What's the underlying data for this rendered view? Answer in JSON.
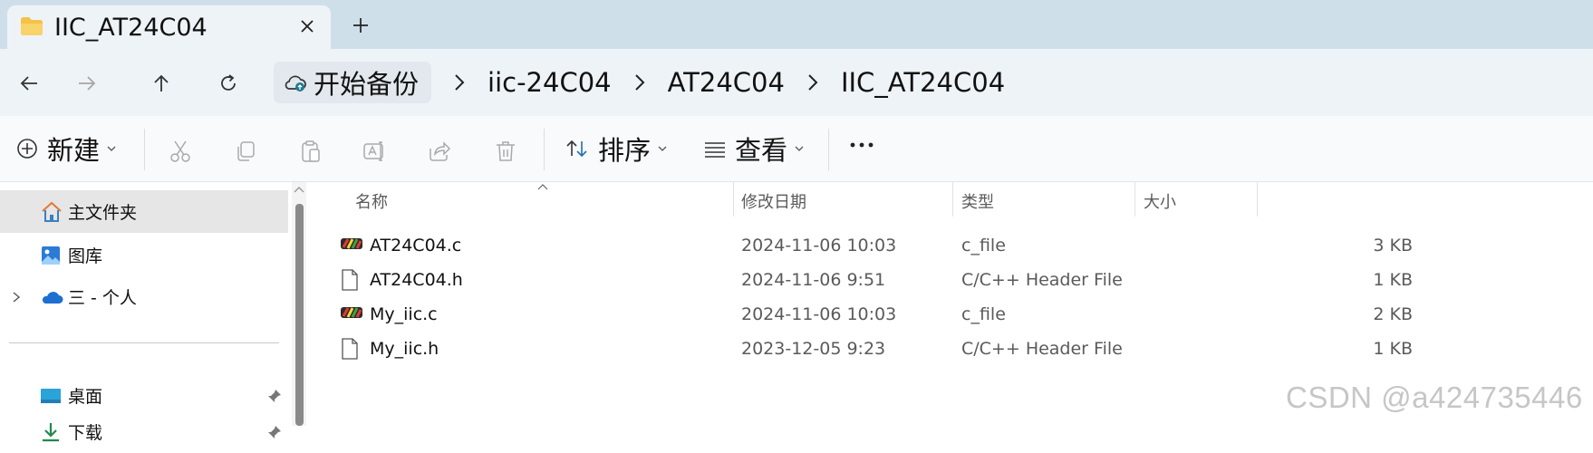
{
  "tab": {
    "title": "IIC_AT24C04",
    "icon": "folder-icon",
    "close_icon": "close-icon",
    "new_tab_icon": "plus-icon"
  },
  "nav": {
    "back_icon": "arrow-left-icon",
    "forward_icon": "arrow-right-icon",
    "up_icon": "arrow-up-icon",
    "refresh_icon": "refresh-icon"
  },
  "breadcrumbs": {
    "home_label": "开始备份",
    "home_icon": "cloud-backup-icon",
    "items": [
      "iic-24C04",
      "AT24C04",
      "IIC_AT24C04"
    ]
  },
  "toolbar": {
    "new_label": "新建",
    "sort_label": "排序",
    "view_label": "查看",
    "more_label": "···",
    "disabled_icons": [
      "cut-icon",
      "copy-icon",
      "paste-icon",
      "rename-icon",
      "share-icon",
      "delete-icon"
    ]
  },
  "sidebar": {
    "items": [
      {
        "label": "主文件夹",
        "icon": "home-icon",
        "selected": true
      },
      {
        "label": "图库",
        "icon": "gallery-icon"
      },
      {
        "label": "三 - 个人",
        "icon": "onedrive-cloud-icon",
        "expandable": true
      },
      {
        "label": "桌面",
        "icon": "desktop-icon",
        "pinned": true
      },
      {
        "label": "下载",
        "icon": "download-icon",
        "pinned": true
      }
    ]
  },
  "columns": {
    "name": "名称",
    "date": "修改日期",
    "type": "类型",
    "size": "大小"
  },
  "files": [
    {
      "name": "AT24C04.c",
      "date": "2024-11-06 10:03",
      "type": "c_file",
      "size": "3 KB",
      "icon": "keil-c-file-icon"
    },
    {
      "name": "AT24C04.h",
      "date": "2024-11-06 9:51",
      "type": "C/C++ Header File",
      "size": "1 KB",
      "icon": "blank-file-icon"
    },
    {
      "name": "My_iic.c",
      "date": "2024-11-06 10:03",
      "type": "c_file",
      "size": "2 KB",
      "icon": "keil-c-file-icon"
    },
    {
      "name": "My_iic.h",
      "date": "2023-12-05 9:23",
      "type": "C/C++ Header File",
      "size": "1 KB",
      "icon": "blank-file-icon"
    }
  ],
  "watermark": "CSDN @a424735446",
  "colors": {
    "tabstrip_bg": "#cfdfe9",
    "navrow_bg": "#eef3f7",
    "selected_bg": "#e6e6e6",
    "folder_yellow": "#f4c246"
  }
}
